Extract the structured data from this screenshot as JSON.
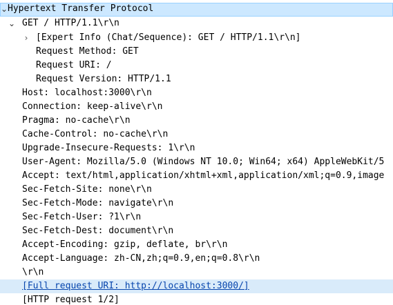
{
  "top_partial": "                    ",
  "tree": {
    "http_header": "Hypertext Transfer Protocol",
    "request_line": "GET / HTTP/1.1\\r\\n",
    "expert_info": "[Expert Info (Chat/Sequence): GET / HTTP/1.1\\r\\n]",
    "request_method": "Request Method: GET",
    "request_uri": "Request URI: /",
    "request_version": "Request Version: HTTP/1.1",
    "headers": [
      "Host: localhost:3000\\r\\n",
      "Connection: keep-alive\\r\\n",
      "Pragma: no-cache\\r\\n",
      "Cache-Control: no-cache\\r\\n",
      "Upgrade-Insecure-Requests: 1\\r\\n",
      "User-Agent: Mozilla/5.0 (Windows NT 10.0; Win64; x64) AppleWebKit/5",
      "Accept: text/html,application/xhtml+xml,application/xml;q=0.9,image",
      "Sec-Fetch-Site: none\\r\\n",
      "Sec-Fetch-Mode: navigate\\r\\n",
      "Sec-Fetch-User: ?1\\r\\n",
      "Sec-Fetch-Dest: document\\r\\n",
      "Accept-Encoding: gzip, deflate, br\\r\\n",
      "Accept-Language: zh-CN,zh;q=0.9,en;q=0.8\\r\\n",
      "\\r\\n"
    ],
    "full_request_uri": "[Full request URI: http://localhost:3000/]",
    "http_request_num": "[HTTP request 1/2]"
  },
  "icons": {
    "expanded": "chevron-down-icon",
    "collapsed": "chevron-right-icon"
  },
  "colors": {
    "selection": "#cce8ff",
    "selection_border": "#99d1ff",
    "highlight": "#d9ebfa",
    "link": "#0645ad"
  }
}
